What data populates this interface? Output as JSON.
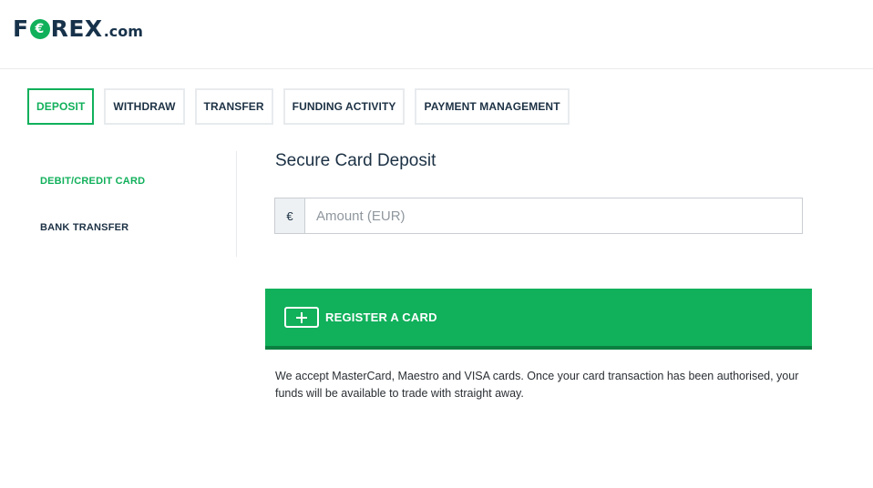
{
  "brand": {
    "logo_prefix": "F",
    "logo_rest": "REX",
    "logo_suffix": ".com",
    "accent_color": "#11b05b",
    "navy_color": "#17324a"
  },
  "tabs": [
    {
      "label": "DEPOSIT",
      "active": true
    },
    {
      "label": "WITHDRAW",
      "active": false
    },
    {
      "label": "TRANSFER",
      "active": false
    },
    {
      "label": "FUNDING ACTIVITY",
      "active": false
    },
    {
      "label": "PAYMENT MANAGEMENT",
      "active": false
    }
  ],
  "sidenav": {
    "items": [
      {
        "label": "DEBIT/CREDIT CARD",
        "active": true
      },
      {
        "label": "BANK TRANSFER",
        "active": false
      }
    ]
  },
  "deposit": {
    "title": "Secure Card Deposit",
    "currency_symbol": "€",
    "amount_value": "",
    "amount_placeholder": "Amount (EUR)",
    "plus_icon": "plus-icon",
    "register_label": "REGISTER A CARD",
    "note": "We accept MasterCard, Maestro and VISA cards. Once your card transaction has been authorised, your funds will be available to trade with straight away."
  }
}
